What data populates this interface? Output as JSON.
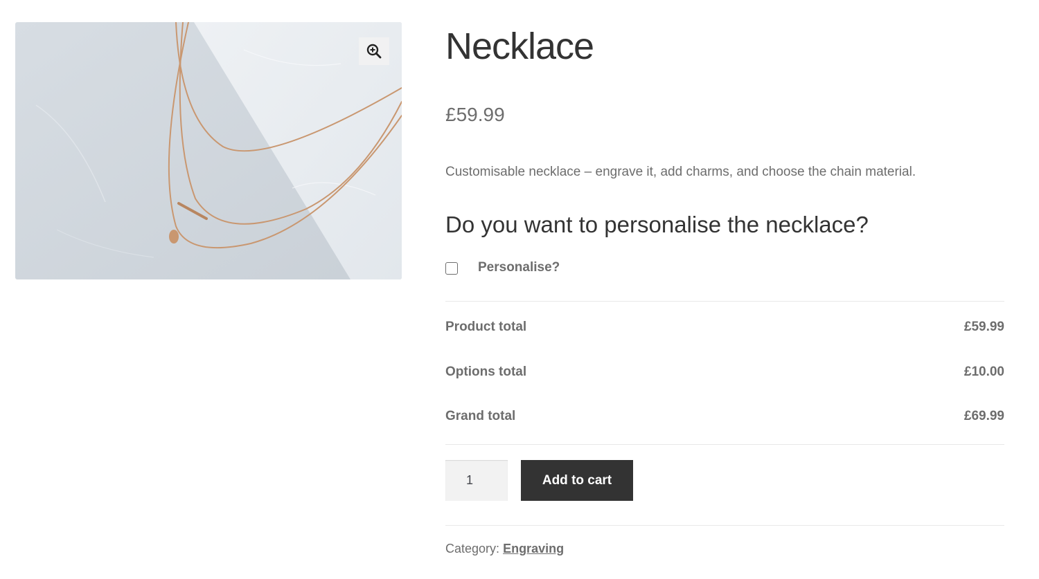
{
  "product": {
    "title": "Necklace",
    "price": "£59.99",
    "description": "Customisable necklace – engrave it, add charms, and choose the chain material."
  },
  "gallery": {
    "image_alt": "Layered gold necklace on marble",
    "zoom_icon": "zoom-in-icon"
  },
  "options": {
    "question": "Do you want to personalise the necklace?",
    "personalise_label": "Personalise?",
    "personalise_checked": false
  },
  "totals": {
    "product_label": "Product total",
    "product_value": "£59.99",
    "options_label": "Options total",
    "options_value": "£10.00",
    "grand_label": "Grand total",
    "grand_value": "£69.99"
  },
  "cart": {
    "quantity": "1",
    "add_label": "Add to cart"
  },
  "meta": {
    "category_label": "Category:",
    "category_value": "Engraving"
  },
  "colors": {
    "button_bg": "#333333",
    "text": "#6d6d6d",
    "heading": "#333333"
  }
}
